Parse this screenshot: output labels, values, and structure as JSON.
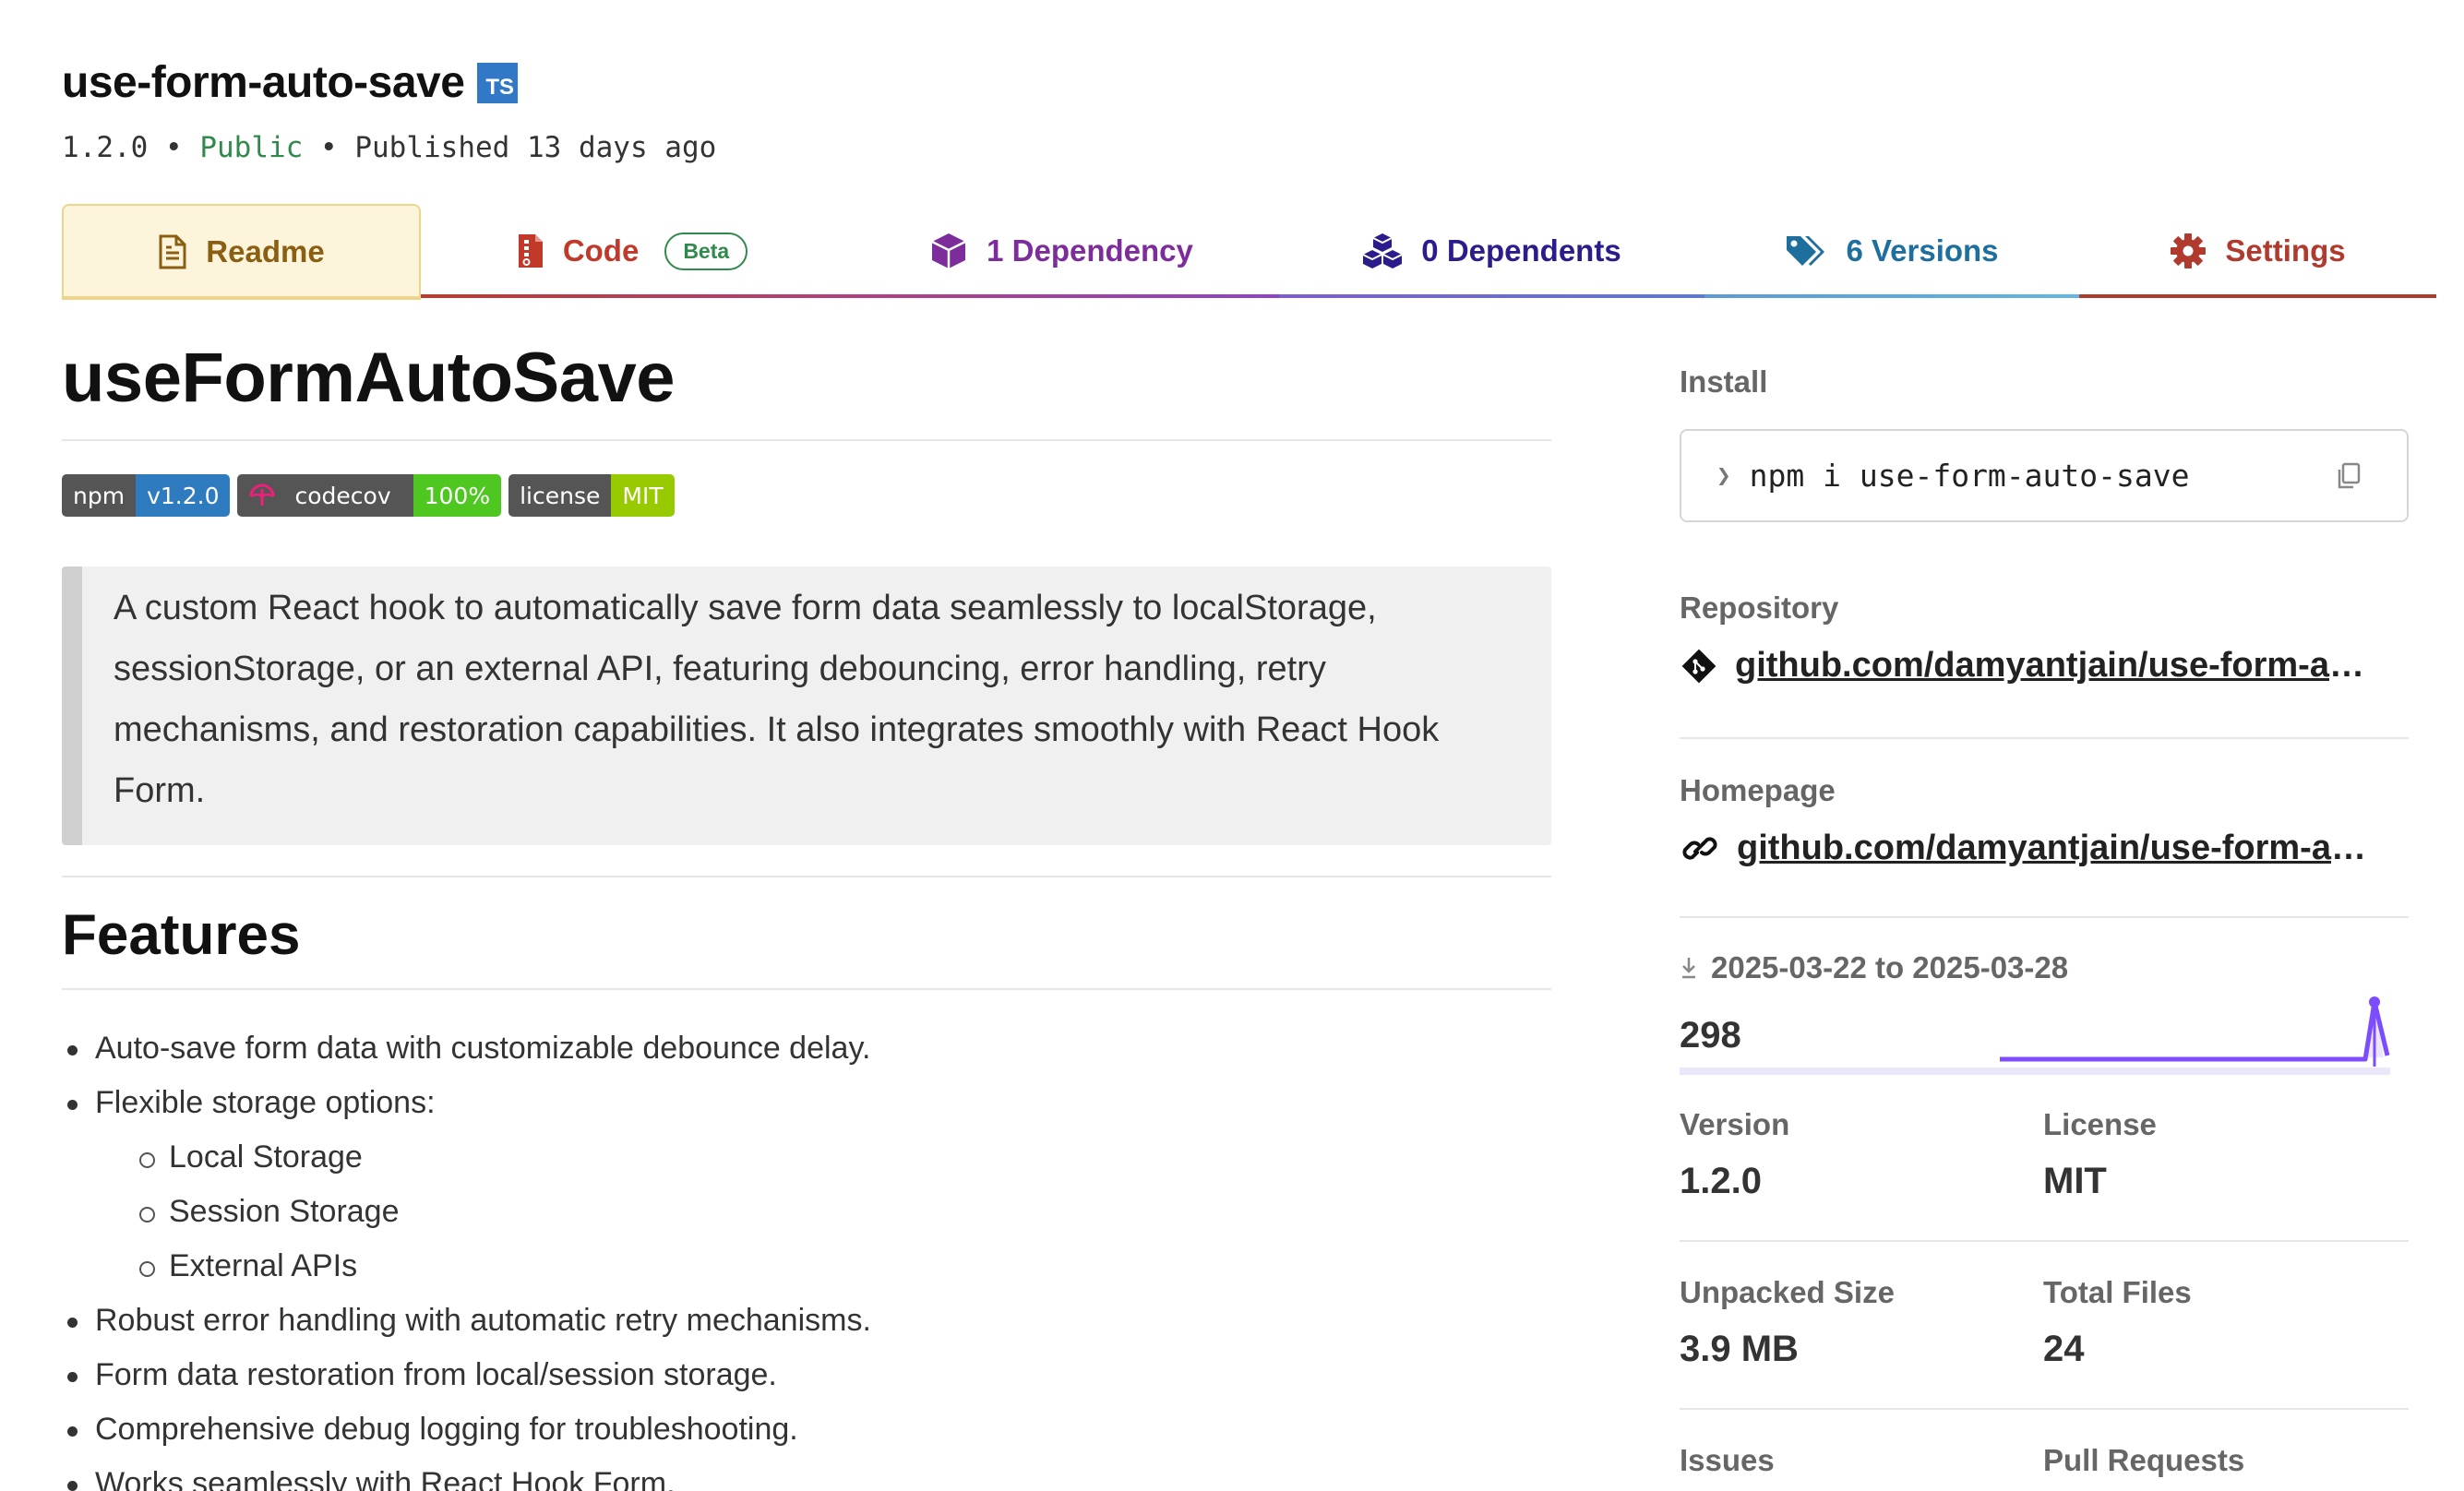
{
  "package": {
    "name": "use-form-auto-save",
    "ts_badge": "TS",
    "version": "1.2.0",
    "separator": "•",
    "visibility": "Public",
    "published": "Published 13 days ago"
  },
  "tabs": [
    {
      "label": "Readme",
      "icon": "readme-icon",
      "color": "#8a5f12"
    },
    {
      "label": "Code",
      "icon": "code-icon",
      "badge": "Beta",
      "color": "#c0392b"
    },
    {
      "label": "1 Dependency",
      "icon": "dependency-icon",
      "color": "#7d2d9b"
    },
    {
      "label": "0 Dependents",
      "icon": "dependents-icon",
      "color": "#2b1c8c"
    },
    {
      "label": "6 Versions",
      "icon": "versions-icon",
      "color": "#1f6f9e"
    },
    {
      "label": "Settings",
      "icon": "settings-icon",
      "color": "#b03a2e"
    }
  ],
  "readme": {
    "title": "useFormAutoSave",
    "badges": [
      {
        "label": "npm",
        "value": "v1.2.0",
        "color": "#2f7bbf"
      },
      {
        "label": "codecov",
        "value": "100%",
        "color": "#4ec820"
      },
      {
        "label": "license",
        "value": "MIT",
        "color": "#97ca00"
      }
    ],
    "description": "A custom React hook to automatically save form data seamlessly to localStorage, sessionStorage, or an external API, featuring debouncing, error handling, retry mechanisms, and restoration capabilities. It also integrates smoothly with React Hook Form.",
    "features_heading": "Features",
    "features": [
      "Auto-save form data with customizable debounce delay.",
      "Flexible storage options:",
      "Robust error handling with automatic retry mechanisms.",
      "Form data restoration from local/session storage.",
      "Comprehensive debug logging for troubleshooting.",
      "Works seamlessly with React Hook Form."
    ],
    "storage_options": [
      "Local Storage",
      "Session Storage",
      "External APIs"
    ]
  },
  "sidebar": {
    "install_label": "Install",
    "install_command": "npm i use-form-auto-save",
    "repository_label": "Repository",
    "repository_link": "github.com/damyantjain/use-form-auto-save",
    "homepage_label": "Homepage",
    "homepage_link": "github.com/damyantjain/use-form-auto-save",
    "downloads_range": "2025-03-22 to 2025-03-28",
    "weekly_downloads": "298",
    "version_label": "Version",
    "version_value": "1.2.0",
    "license_label": "License",
    "license_value": "MIT",
    "unpacked_size_label": "Unpacked Size",
    "unpacked_size_value": "3.9 MB",
    "total_files_label": "Total Files",
    "total_files_value": "24",
    "issues_label": "Issues",
    "pull_requests_label": "Pull Requests"
  },
  "colors": {
    "public": "#2f8a4c",
    "sparkline": "#7c4dff"
  }
}
